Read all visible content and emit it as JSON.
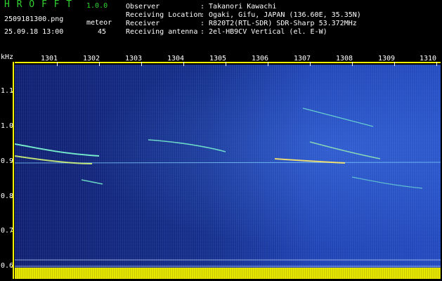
{
  "app": {
    "title": "H R O F F T",
    "version": "1.0.0"
  },
  "file": {
    "name": "2509181300.png",
    "datetime": "25.09.18 13:00"
  },
  "detection": {
    "label": "meteor",
    "count": "45"
  },
  "info": [
    {
      "label": "Observer",
      "value": ": Takanori Kawachi"
    },
    {
      "label": "Receiving Location",
      "value": ": Ogaki, Gifu, JAPAN (136.60E, 35.35N)"
    },
    {
      "label": "Receiver",
      "value": ": R820T2(RTL-SDR) SDR-Sharp 53.372MHz"
    },
    {
      "label": "Receiving antenna",
      "value": ": 2el-HB9CV Vertical (el. E-W)"
    }
  ],
  "axis": {
    "unit": "kHz",
    "time_ticks": [
      "1301",
      "1302",
      "1303",
      "1304",
      "1305",
      "1306",
      "1307",
      "1308",
      "1309",
      "1310"
    ],
    "freq_ticks": [
      "1.1",
      "1.0",
      "0.9",
      "0.8",
      "0.7",
      "0.6"
    ]
  },
  "colors": {
    "label_green": "#31d331",
    "axis_yellow": "#f4f400",
    "background": "#000000",
    "spectrogram_blue": "#1e46bb"
  }
}
